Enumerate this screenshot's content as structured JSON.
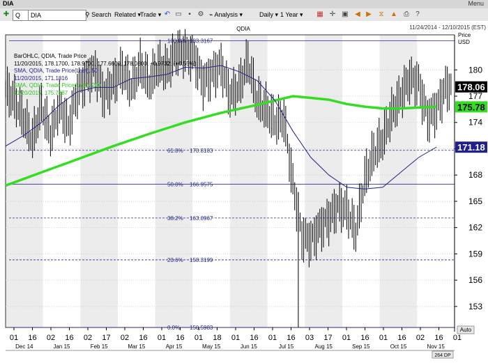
{
  "window": {
    "title": "DIA",
    "menu_label": "Menu"
  },
  "toolbar": {
    "symbol_mode": "Q",
    "symbol_value": "DIA",
    "search": "Search",
    "related": "Related",
    "trade": "Trade",
    "analysis": "Analysis",
    "interval": "Daily",
    "range": "1 Year"
  },
  "chart_header": {
    "symbol": "QDIA",
    "date_range": "11/24/2014 - 12/10/2015 (EST)",
    "price_label": "Price",
    "currency": "USD"
  },
  "legend": {
    "line1": "BarOHLC, QDIA, Trade Price",
    "line2": "11/20/2015, 178.1700, 178.9700, 177.6600, 178.0600, +0.9732, (+0.55%)",
    "line3": "SMA, QDIA, Trade Price(Last), 50",
    "line4": "11/20/2015, 171.1816",
    "line5": "SMA, QDIA, Trade Price(Last), 200",
    "line6": "11/20/2015, 175.7887"
  },
  "colors": {
    "price_bars": "#000000",
    "sma50": "#1f1f8f",
    "sma200": "#33dd22",
    "fib": "#2a2a8a",
    "badge_last": "#000000",
    "badge_sma200": "#33dd22",
    "badge_sma50": "#1f1f8f"
  },
  "chart_data": {
    "type": "line",
    "title": "QDIA",
    "ylim": [
      150.6,
      184.0
    ],
    "yticks": [
      153,
      156,
      159,
      162,
      165,
      168,
      171,
      174,
      177,
      180
    ],
    "xlabel": "",
    "ylabel": "Price USD",
    "x_tick_labels": [
      "01",
      "16",
      "02",
      "16",
      "02",
      "17",
      "02",
      "16",
      "01",
      "16",
      "01",
      "18",
      "01",
      "16",
      "01",
      "16",
      "03",
      "17",
      "01",
      "16",
      "01",
      "16",
      "02",
      "16",
      "01"
    ],
    "month_labels": [
      "Dec 14",
      "Jan 15",
      "Feb 15",
      "Mar 15",
      "Apr 15",
      "May 15",
      "Jun 15",
      "Jul 15",
      "Aug 15",
      "Sep 15",
      "Oct 15",
      "Nov 15"
    ],
    "fibonacci": [
      {
        "label": "100.0%",
        "value": 183.3167
      },
      {
        "label": "61.8%",
        "value": 170.8183
      },
      {
        "label": "50.0%",
        "value": 166.9575
      },
      {
        "label": "38.2%",
        "value": 163.0967
      },
      {
        "label": "23.6%",
        "value": 158.3199
      },
      {
        "label": "0.0%",
        "value": 150.5983
      }
    ],
    "last_values": {
      "price": 178.06,
      "sma200": 175.78,
      "sma50": 171.18
    },
    "series": [
      {
        "name": "QDIA",
        "points": [
          [
            0,
            177.8
          ],
          [
            5,
            176.5
          ],
          [
            10,
            174.5
          ],
          [
            15,
            172.0
          ],
          [
            20,
            176.0
          ],
          [
            25,
            172.5
          ],
          [
            30,
            176.0
          ],
          [
            35,
            173.5
          ],
          [
            40,
            177.5
          ],
          [
            45,
            179.0
          ],
          [
            50,
            180.0
          ],
          [
            55,
            177.0
          ],
          [
            60,
            178.5
          ],
          [
            65,
            180.0
          ],
          [
            70,
            178.0
          ],
          [
            75,
            180.5
          ],
          [
            80,
            178.5
          ],
          [
            85,
            180.5
          ],
          [
            90,
            180.0
          ],
          [
            95,
            182.0
          ],
          [
            100,
            182.0
          ],
          [
            105,
            181.5
          ],
          [
            110,
            178.5
          ],
          [
            115,
            179.5
          ],
          [
            120,
            180.5
          ],
          [
            125,
            177.0
          ],
          [
            130,
            178.0
          ],
          [
            135,
            181.0
          ],
          [
            140,
            176.5
          ],
          [
            145,
            175.5
          ],
          [
            150,
            174.0
          ],
          [
            155,
            174.5
          ],
          [
            160,
            167.0
          ],
          [
            165,
            161.0
          ],
          [
            170,
            160.5
          ],
          [
            175,
            162.0
          ],
          [
            180,
            163.0
          ],
          [
            185,
            164.5
          ],
          [
            190,
            164.0
          ],
          [
            195,
            161.5
          ],
          [
            200,
            167.5
          ],
          [
            205,
            170.5
          ],
          [
            210,
            172.0
          ],
          [
            215,
            175.0
          ],
          [
            220,
            177.0
          ],
          [
            225,
            179.0
          ],
          [
            230,
            178.5
          ],
          [
            235,
            174.5
          ],
          [
            240,
            175.5
          ],
          [
            245,
            178.0
          ]
        ]
      },
      {
        "name": "SMA 50",
        "points": [
          [
            0,
            171.3
          ],
          [
            10,
            172.5
          ],
          [
            20,
            174.0
          ],
          [
            30,
            176.0
          ],
          [
            40,
            177.5
          ],
          [
            50,
            178.0
          ],
          [
            60,
            178.0
          ],
          [
            70,
            179.0
          ],
          [
            80,
            179.2
          ],
          [
            90,
            179.5
          ],
          [
            100,
            180.3
          ],
          [
            110,
            180.2
          ],
          [
            120,
            180.5
          ],
          [
            130,
            179.8
          ],
          [
            140,
            178.8
          ],
          [
            150,
            176.5
          ],
          [
            160,
            173.0
          ],
          [
            170,
            170.0
          ],
          [
            180,
            168.0
          ],
          [
            190,
            166.6
          ],
          [
            200,
            166.4
          ],
          [
            210,
            166.6
          ],
          [
            220,
            168.3
          ],
          [
            230,
            170.0
          ],
          [
            240,
            171.2
          ]
        ]
      },
      {
        "name": "SMA 200",
        "points": [
          [
            0,
            166.8
          ],
          [
            20,
            168.3
          ],
          [
            40,
            169.8
          ],
          [
            60,
            171.3
          ],
          [
            80,
            172.7
          ],
          [
            100,
            174.0
          ],
          [
            120,
            175.1
          ],
          [
            140,
            176.0
          ],
          [
            160,
            177.0
          ],
          [
            170,
            176.8
          ],
          [
            180,
            176.6
          ],
          [
            190,
            176.1
          ],
          [
            200,
            175.8
          ],
          [
            210,
            175.6
          ],
          [
            220,
            175.6
          ],
          [
            230,
            175.7
          ],
          [
            240,
            175.8
          ]
        ]
      }
    ],
    "x_range": [
      0,
      250
    ]
  },
  "footer": {
    "auto_label": "Auto",
    "dp_label": "264 DP"
  }
}
